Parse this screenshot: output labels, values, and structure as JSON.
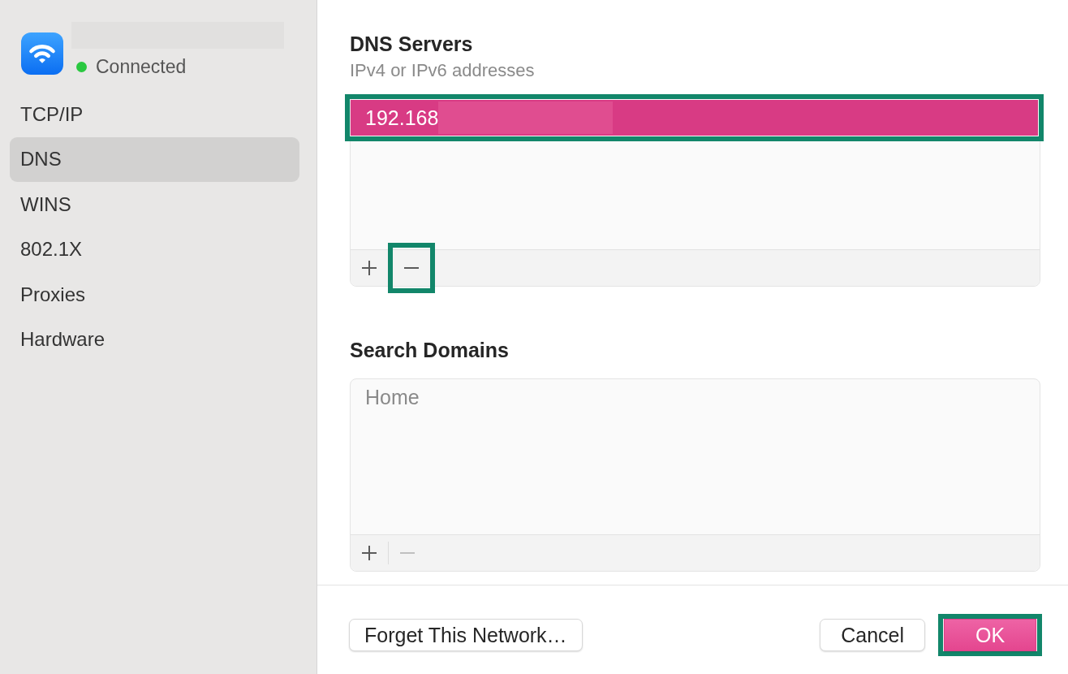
{
  "sidebar": {
    "network": {
      "name_redacted": true,
      "connected": true,
      "status": "Connected"
    },
    "items": [
      {
        "label": "TCP/IP",
        "selected": false
      },
      {
        "label": "DNS",
        "selected": true
      },
      {
        "label": "WINS",
        "selected": false
      },
      {
        "label": "802.1X",
        "selected": false
      },
      {
        "label": "Proxies",
        "selected": false
      },
      {
        "label": "Hardware",
        "selected": false
      }
    ]
  },
  "dns_servers": {
    "title": "DNS Servers",
    "subtitle": "IPv4 or IPv6 addresses",
    "entries": [
      {
        "value": "192.168",
        "selected": true,
        "disabled": false,
        "redacted": true,
        "highlighted": true
      }
    ],
    "toolbar": [
      {
        "kind": "add",
        "disabled": false,
        "highlighted": false
      },
      {
        "kind": "remove",
        "disabled": false,
        "highlighted": true
      }
    ]
  },
  "search_domains": {
    "title": "Search Domains",
    "entries": [
      {
        "value": "Home",
        "selected": false,
        "disabled": true,
        "redacted": false,
        "highlighted": false
      }
    ],
    "toolbar": [
      {
        "kind": "add",
        "disabled": false,
        "highlighted": false
      },
      {
        "kind": "remove",
        "disabled": true,
        "highlighted": false
      }
    ]
  },
  "footer": {
    "left": [
      {
        "label": "Forget This Network…",
        "kind": "push",
        "highlighted": false
      }
    ],
    "right": [
      {
        "label": "Cancel",
        "kind": "push",
        "highlighted": false
      },
      {
        "label": "OK",
        "kind": "default",
        "highlighted": true
      }
    ]
  }
}
